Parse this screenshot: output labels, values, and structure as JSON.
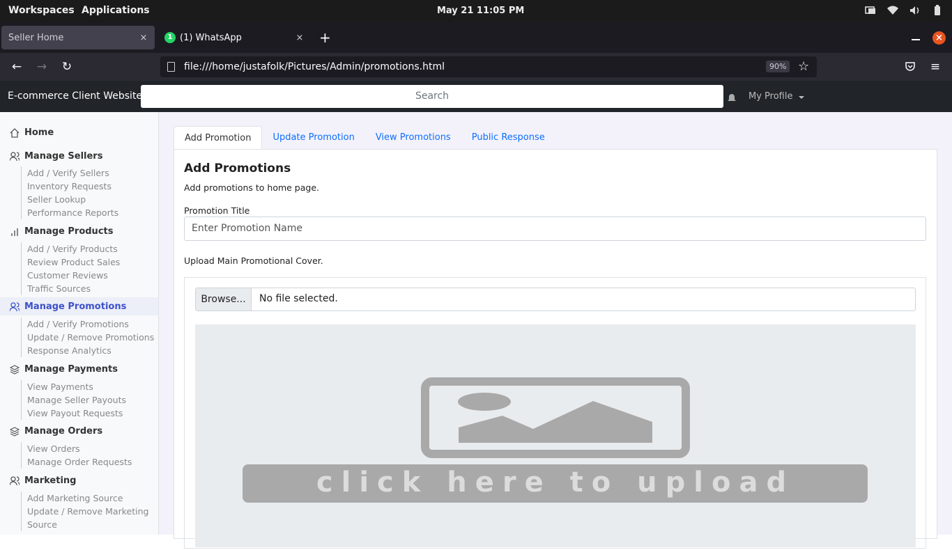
{
  "system": {
    "workspaces": "Workspaces",
    "applications": "Applications",
    "clock": "May 21  11:05 PM"
  },
  "browser": {
    "tabs": [
      {
        "title": "Seller Home",
        "close": "×"
      },
      {
        "title": "(1) WhatsApp",
        "badge": "1",
        "close": "×"
      }
    ],
    "new_tab": "+",
    "window_close": "×",
    "url": "file:///home/justafolk/Pictures/Admin/promotions.html",
    "zoom": "90%",
    "back": "←",
    "forward": "→",
    "reload": "↻",
    "star": "☆",
    "menu": "≡"
  },
  "header": {
    "brand": "E-commerce Client Website",
    "search_placeholder": "Search",
    "profile": "My Profile"
  },
  "sidebar": {
    "home": "Home",
    "sections": [
      {
        "title": "Manage Sellers",
        "items": [
          "Add / Verify Sellers",
          "Inventory Requests",
          "Seller Lookup",
          "Performance Reports"
        ]
      },
      {
        "title": "Manage Products",
        "items": [
          "Add / Verify Products",
          "Review Product Sales",
          "Customer Reviews",
          "Traffic Sources"
        ]
      },
      {
        "title": "Manage Promotions",
        "items": [
          "Add / Verify Promotions",
          "Update / Remove Promotions",
          "Response Analytics"
        ]
      },
      {
        "title": "Manage Payments",
        "items": [
          "View Payments",
          "Manage Seller Payouts",
          "View Payout Requests"
        ]
      },
      {
        "title": "Manage Orders",
        "items": [
          "View Orders",
          "Manage Order Requests"
        ]
      },
      {
        "title": "Marketing",
        "items": [
          "Add Marketing Source",
          "Update / Remove Marketing",
          "Source"
        ]
      }
    ]
  },
  "main": {
    "tabs": [
      "Add Promotion",
      "Update Promotion",
      "View Promotions",
      "Public Response"
    ],
    "heading": "Add Promotions",
    "description": "Add promotions to home page.",
    "title_label": "Promotion Title",
    "title_placeholder": "Enter Promotion Name",
    "upload_label": "Upload Main Promotional Cover.",
    "browse": "Browse...",
    "no_file": "No file selected.",
    "upload_caption": "click here to upload"
  }
}
